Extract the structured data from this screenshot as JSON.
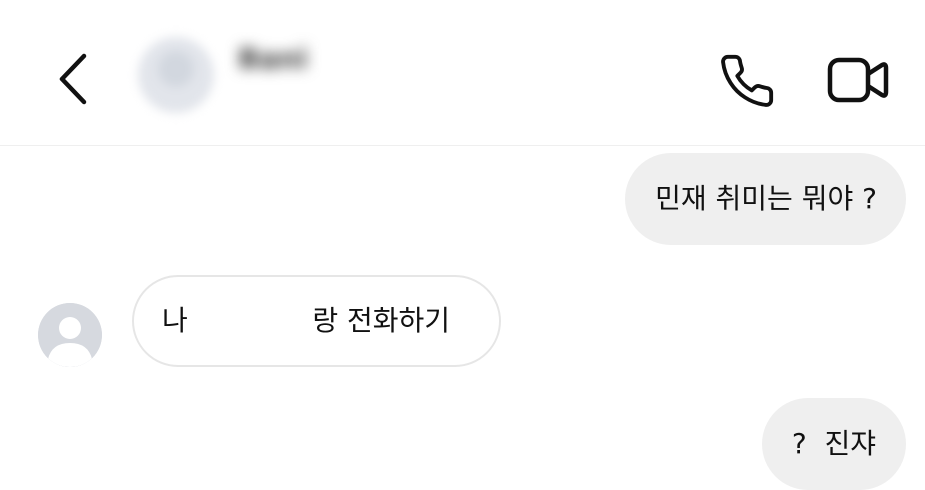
{
  "header": {
    "contact_name": "Bani",
    "contact_status": "",
    "icons": {
      "back": "chevron-left-icon",
      "call": "phone-icon",
      "video": "video-camera-icon"
    }
  },
  "messages": [
    {
      "direction": "outgoing",
      "text": "민재 취미는 뭐야 ?"
    },
    {
      "direction": "incoming",
      "text": "나              랑 전화하기"
    },
    {
      "direction": "outgoing",
      "text": "?  진쟈"
    }
  ],
  "colors": {
    "outgoing_bubble": "#efefef",
    "incoming_bubble_border": "#e6e6e6",
    "icon_stroke": "#111111",
    "avatar_placeholder": "#d6d9df"
  }
}
